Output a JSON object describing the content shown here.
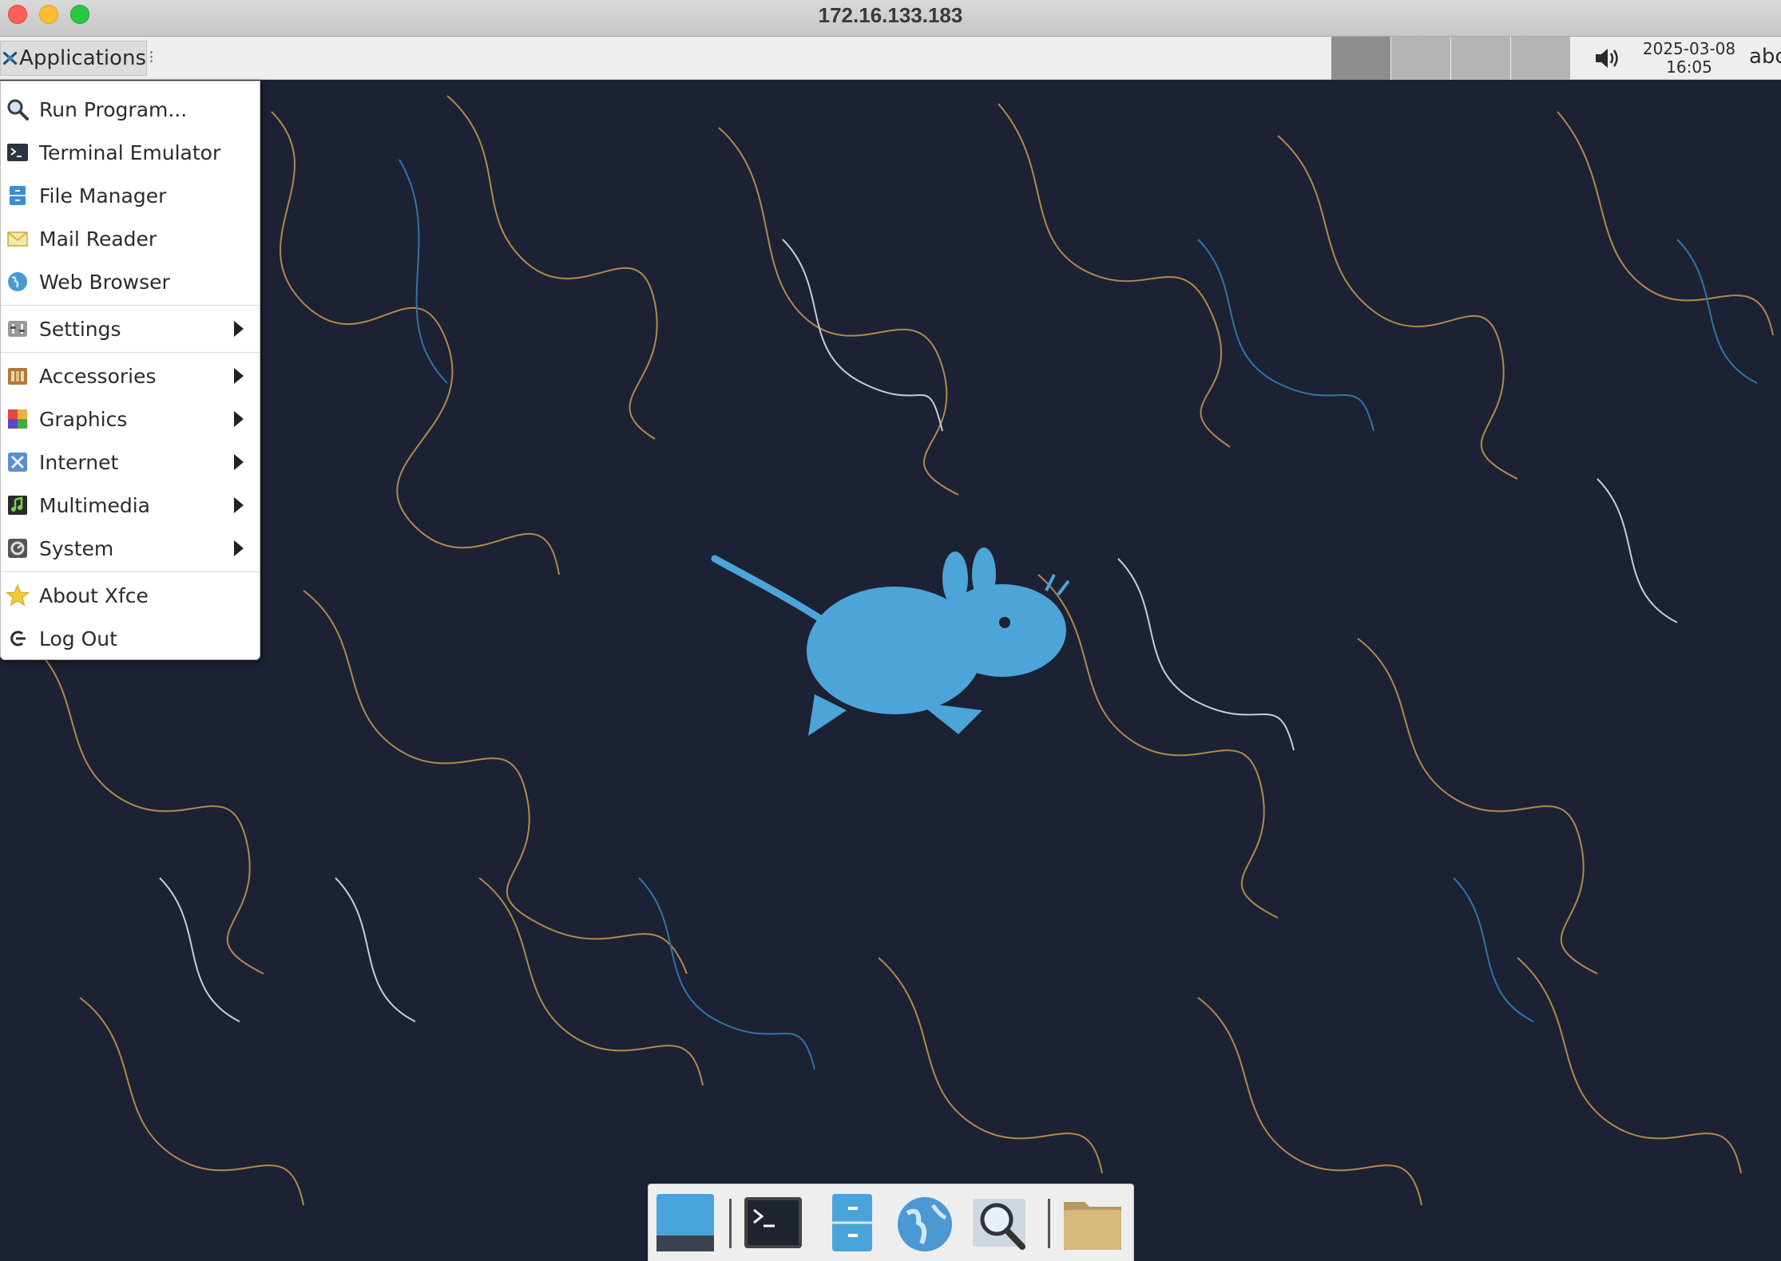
{
  "window": {
    "title": "172.16.133.183"
  },
  "panel": {
    "applications_label": "Applications",
    "grip": "⁝",
    "workspaces": [
      {
        "index": 1,
        "active": true
      },
      {
        "index": 2,
        "active": false
      },
      {
        "index": 3,
        "active": false
      },
      {
        "index": 4,
        "active": false
      }
    ],
    "volume_icon": "speaker-volume-icon",
    "clock_date": "2025-03-08",
    "clock_time": "16:05",
    "user": "abc"
  },
  "menu": {
    "items": [
      {
        "label": "Run Program...",
        "icon": "search-icon"
      },
      {
        "label": "Terminal Emulator",
        "icon": "terminal-icon"
      },
      {
        "label": "File Manager",
        "icon": "file-cabinet-icon"
      },
      {
        "label": "Mail Reader",
        "icon": "envelope-icon"
      },
      {
        "label": "Web Browser",
        "icon": "globe-icon"
      },
      {
        "label": "Settings",
        "icon": "settings-icon",
        "submenu": true
      },
      {
        "label": "Accessories",
        "icon": "accessories-icon",
        "submenu": true
      },
      {
        "label": "Graphics",
        "icon": "graphics-icon",
        "submenu": true
      },
      {
        "label": "Internet",
        "icon": "internet-icon",
        "submenu": true
      },
      {
        "label": "Multimedia",
        "icon": "multimedia-icon",
        "submenu": true
      },
      {
        "label": "System",
        "icon": "system-icon",
        "submenu": true
      },
      {
        "label": "About Xfce",
        "icon": "star-icon"
      },
      {
        "label": "Log Out",
        "icon": "logout-icon"
      }
    ]
  },
  "dock": {
    "items": [
      {
        "name": "show-desktop",
        "icon": "desktop-icon"
      },
      {
        "name": "terminal",
        "icon": "terminal-icon"
      },
      {
        "name": "file-manager",
        "icon": "file-cabinet-icon"
      },
      {
        "name": "web-browser",
        "icon": "globe-icon"
      },
      {
        "name": "app-finder",
        "icon": "search-icon"
      },
      {
        "name": "home-folder",
        "icon": "folder-icon"
      }
    ]
  },
  "colors": {
    "wallpaper_bg": "#1c2233",
    "mouse_blue": "#4ca4d8",
    "line_orange": "#b08a4a",
    "line_blue": "#2f74a8",
    "line_white": "#c9ccd4"
  }
}
